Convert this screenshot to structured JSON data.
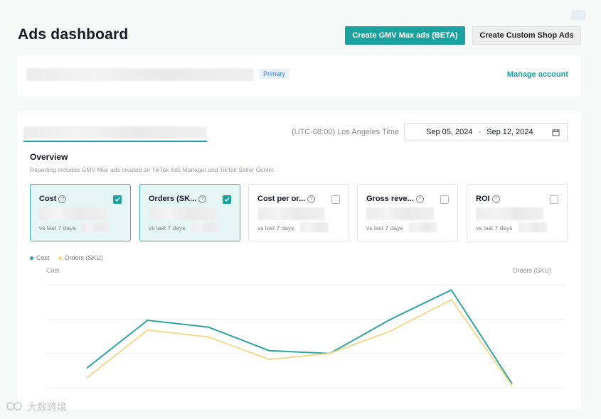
{
  "header": {
    "title": "Ads dashboard",
    "create_gmv_label": "Create GMV Max ads (BETA)",
    "create_custom_label": "Create Custom Shop Ads"
  },
  "account": {
    "badge": "Primary",
    "manage_label": "Manage account"
  },
  "filters": {
    "timezone": "(UTC-08:00) Los Angeles Time",
    "date_start": "Sep 05, 2024",
    "date_sep": "-",
    "date_end": "Sep 12, 2024"
  },
  "overview": {
    "title": "Overview",
    "note": "Reporting includes GMV Max ads created on TikTok Ads Manager and TikTok Seller Center."
  },
  "metrics": [
    {
      "name": "Cost",
      "compare": "vs last 7 days",
      "checked": true
    },
    {
      "name": "Orders (SK...",
      "compare": "vs last 7 days",
      "checked": true
    },
    {
      "name": "Cost per or...",
      "compare": "vs last 7 days",
      "checked": false
    },
    {
      "name": "Gross reve...",
      "compare": "vs last 7 days",
      "checked": false
    },
    {
      "name": "ROI",
      "compare": "vs last 7 days",
      "checked": false
    }
  ],
  "colors": {
    "accent": "#1aa2a0",
    "cost_line": "#2aa5a0",
    "orders_line": "#f5d98a"
  },
  "chart_data": {
    "type": "line",
    "series": [
      {
        "name": "Cost",
        "values": [
          0.2,
          0.69,
          0.62,
          0.38,
          0.35,
          0.7,
          1.0,
          0.04
        ]
      },
      {
        "name": "Orders (SKU)",
        "values": [
          0.1,
          0.59,
          0.52,
          0.29,
          0.35,
          0.58,
          0.9,
          0.02
        ]
      }
    ],
    "ylabel_left": "Cost",
    "ylabel_right": "Orders (SKU)",
    "legend_position": "top-left",
    "grid": true
  },
  "watermark": "大数跨境"
}
